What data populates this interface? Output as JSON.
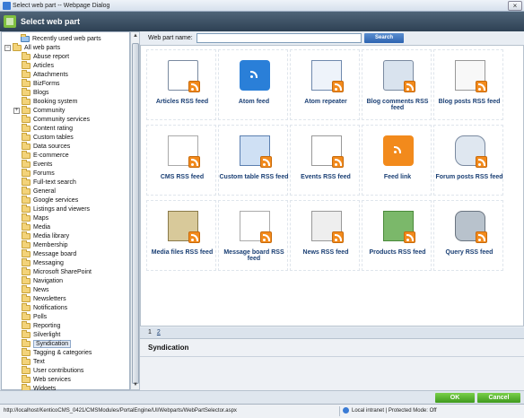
{
  "window": {
    "title": "Select web part -- Webpage Dialog"
  },
  "header": {
    "title": "Select web part"
  },
  "tree": {
    "recent": "Recently used web parts",
    "root": "All web parts",
    "items": [
      "Abuse report",
      "Articles",
      "Attachments",
      "BizForms",
      "Blogs",
      "Booking system",
      "Community",
      "Community services",
      "Content rating",
      "Custom tables",
      "Data sources",
      "E-commerce",
      "Events",
      "Forums",
      "Full-text search",
      "General",
      "Google services",
      "Listings and viewers",
      "Maps",
      "Media",
      "Media library",
      "Membership",
      "Message board",
      "Messaging",
      "Microsoft SharePoint",
      "Navigation",
      "News",
      "Newsletters",
      "Notifications",
      "Polls",
      "Reporting",
      "Silverlight",
      "Syndication",
      "Tagging & categories",
      "Text",
      "User contributions",
      "Web services",
      "Widgets"
    ],
    "selected": "Syndication"
  },
  "search": {
    "label": "Web part name:",
    "value": "",
    "button": "Search"
  },
  "webparts": [
    {
      "label": "Articles RSS feed",
      "icon": "articles-rss-icon"
    },
    {
      "label": "Atom feed",
      "icon": "atom-feed-icon"
    },
    {
      "label": "Atom repeater",
      "icon": "atom-repeater-icon"
    },
    {
      "label": "Blog comments RSS feed",
      "icon": "blog-comments-rss-icon"
    },
    {
      "label": "Blog posts RSS feed",
      "icon": "blog-posts-rss-icon"
    },
    {
      "label": "CMS RSS feed",
      "icon": "cms-rss-icon"
    },
    {
      "label": "Custom table RSS feed",
      "icon": "custom-table-rss-icon"
    },
    {
      "label": "Events RSS feed",
      "icon": "events-rss-icon"
    },
    {
      "label": "Feed link",
      "icon": "feed-link-icon"
    },
    {
      "label": "Forum posts RSS feed",
      "icon": "forum-posts-rss-icon"
    },
    {
      "label": "Media files RSS feed",
      "icon": "media-files-rss-icon"
    },
    {
      "label": "Message board RSS feed",
      "icon": "message-board-rss-icon"
    },
    {
      "label": "News RSS feed",
      "icon": "news-rss-icon"
    },
    {
      "label": "Products RSS feed",
      "icon": "products-rss-icon"
    },
    {
      "label": "Query RSS feed",
      "icon": "query-rss-icon"
    }
  ],
  "pager": {
    "pages": [
      "1",
      "2"
    ],
    "current": "1"
  },
  "category": {
    "title": "Syndication"
  },
  "buttons": {
    "ok": "OK",
    "cancel": "Cancel"
  },
  "statusbar": {
    "url": "http://localhost/KenticoCMS_0421/CMSModules/PortalEngine/UI/Webparts/WebPartSelector.aspx",
    "zone": "Local intranet | Protected Mode: Off"
  },
  "colors": {
    "header": "#2e4154",
    "rss": "#f28a1c",
    "ok": "#3f9a1e",
    "link": "#1a3f74"
  }
}
